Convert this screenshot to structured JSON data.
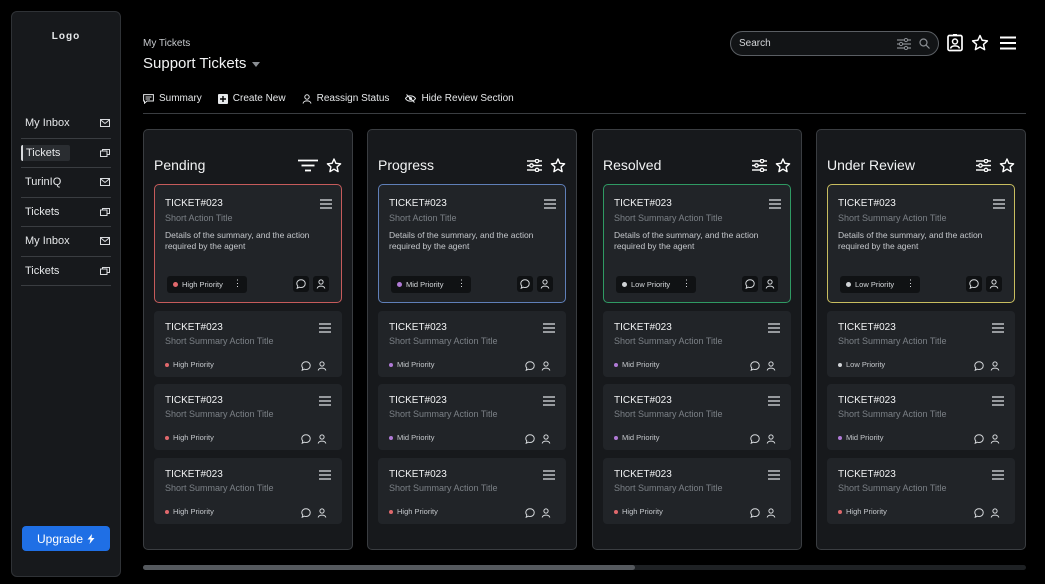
{
  "logo_text": "Logo",
  "sidebar": {
    "items": [
      {
        "label": "My Inbox",
        "icon": "mail-icon"
      },
      {
        "label": "Tickets",
        "icon": "copy-icon"
      },
      {
        "label": "TurinIQ",
        "icon": "mail-icon"
      },
      {
        "label": "Tickets",
        "icon": "copy-icon"
      },
      {
        "label": "My Inbox",
        "icon": "mail-icon"
      },
      {
        "label": "Tickets",
        "icon": "copy-icon"
      }
    ],
    "active_index": 1,
    "upgrade_label": "Upgrade"
  },
  "header": {
    "breadcrumb": "My Tickets",
    "title": "Support Tickets",
    "search_placeholder": "Search"
  },
  "toolbar": {
    "summary": "Summary",
    "create_new": "Create New",
    "reassign_status": "Reassign Status",
    "hide_review": "Hide Review Section"
  },
  "colors": {
    "pending_border": "#c65b5b",
    "progress_border": "#5f7fb8",
    "resolved_border": "#2f9a63",
    "review_border": "#c8bd5f",
    "high": "#e0686c",
    "mid": "#b07ad6",
    "low": "#d0d3d6",
    "accent": "#1f6fe5"
  },
  "columns": [
    {
      "title": "Pending",
      "featured": {
        "ticket": "TICKET#023",
        "subtitle": "Short Action Title",
        "details": "Details of the summary, and the action required by the agent",
        "priority": "High Priority",
        "level": "high"
      },
      "cards": [
        {
          "ticket": "TICKET#023",
          "subtitle": "Short Summary Action Title",
          "priority": "High Priority",
          "level": "high"
        },
        {
          "ticket": "TICKET#023",
          "subtitle": "Short Summary Action Title",
          "priority": "High Priority",
          "level": "high"
        },
        {
          "ticket": "TICKET#023",
          "subtitle": "Short Summary Action Title",
          "priority": "High Priority",
          "level": "high"
        }
      ]
    },
    {
      "title": "Progress",
      "featured": {
        "ticket": "TICKET#023",
        "subtitle": "Short Action Title",
        "details": "Details of the summary, and the action required by the agent",
        "priority": "Mid Priority",
        "level": "mid"
      },
      "cards": [
        {
          "ticket": "TICKET#023",
          "subtitle": "Short Summary Action Title",
          "priority": "Mid Priority",
          "level": "mid"
        },
        {
          "ticket": "TICKET#023",
          "subtitle": "Short Summary Action Title",
          "priority": "Mid Priority",
          "level": "mid"
        },
        {
          "ticket": "TICKET#023",
          "subtitle": "Short Summary Action Title",
          "priority": "High Priority",
          "level": "high"
        }
      ]
    },
    {
      "title": "Resolved",
      "featured": {
        "ticket": "TICKET#023",
        "subtitle": "Short Summary Action Title",
        "details": "Details of the summary, and the action required by the agent",
        "priority": "Low Priority",
        "level": "low"
      },
      "cards": [
        {
          "ticket": "TICKET#023",
          "subtitle": "Short Summary Action Title",
          "priority": "Mid Priority",
          "level": "mid"
        },
        {
          "ticket": "TICKET#023",
          "subtitle": "Short Summary Action Title",
          "priority": "Mid Priority",
          "level": "mid"
        },
        {
          "ticket": "TICKET#023",
          "subtitle": "Short Summary Action Title",
          "priority": "High Priority",
          "level": "high"
        }
      ]
    },
    {
      "title": "Under Review",
      "featured": {
        "ticket": "TICKET#023",
        "subtitle": "Short Summary Action Title",
        "details": "Details of the summary, and the action required by the agent",
        "priority": "Low Priority",
        "level": "low"
      },
      "cards": [
        {
          "ticket": "TICKET#023",
          "subtitle": "Short Summary Action Title",
          "priority": "Low Priority",
          "level": "low"
        },
        {
          "ticket": "TICKET#023",
          "subtitle": "Short Summary Action Title",
          "priority": "Mid Priority",
          "level": "mid"
        },
        {
          "ticket": "TICKET#023",
          "subtitle": "Short Summary Action Title",
          "priority": "High Priority",
          "level": "high"
        }
      ]
    }
  ]
}
